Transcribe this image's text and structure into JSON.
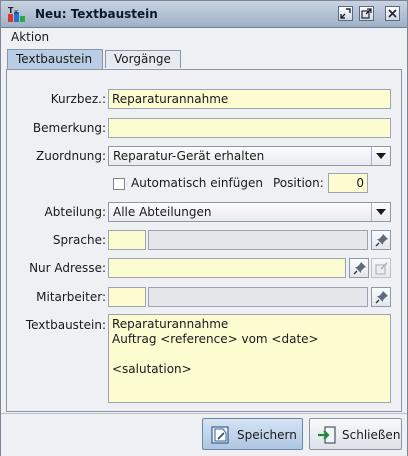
{
  "window": {
    "title": "Neu: Textbaustein"
  },
  "menu": {
    "items": [
      {
        "label": "Aktion"
      }
    ]
  },
  "tabs": [
    {
      "label": "Textbaustein",
      "active": true
    },
    {
      "label": "Vorgänge",
      "active": false
    }
  ],
  "form": {
    "kurzbez": {
      "label": "Kurzbez.:",
      "value": "Reparaturannahme"
    },
    "bemerkung": {
      "label": "Bemerkung:",
      "value": ""
    },
    "zuordnung": {
      "label": "Zuordnung:",
      "value": "Reparatur-Gerät erhalten"
    },
    "automatisch": {
      "label": "Automatisch einfügen",
      "checked": false
    },
    "position": {
      "label": "Position:",
      "value": "0"
    },
    "abteilung": {
      "label": "Abteilung:",
      "value": "Alle Abteilungen"
    },
    "sprache": {
      "label": "Sprache:",
      "code": "",
      "name": ""
    },
    "nur_adresse": {
      "label": "Nur Adresse:",
      "value": ""
    },
    "mitarbeiter": {
      "label": "Mitarbeiter:",
      "code": "",
      "name": ""
    },
    "textbaustein": {
      "label": "Textbaustein:",
      "value": "Reparaturannahme\nAuftrag <reference> vom <date>\n\n<salutation>"
    }
  },
  "buttons": {
    "save": "Speichern",
    "close": "Schließen"
  },
  "icons": {
    "app": "app-logo-icon",
    "pin": "pin-icon",
    "edit": "edit-icon"
  },
  "colors": {
    "field_bg": "#fdfbd0",
    "tab_active": "#b9cde4",
    "titlebar": "#9fb1c8"
  }
}
